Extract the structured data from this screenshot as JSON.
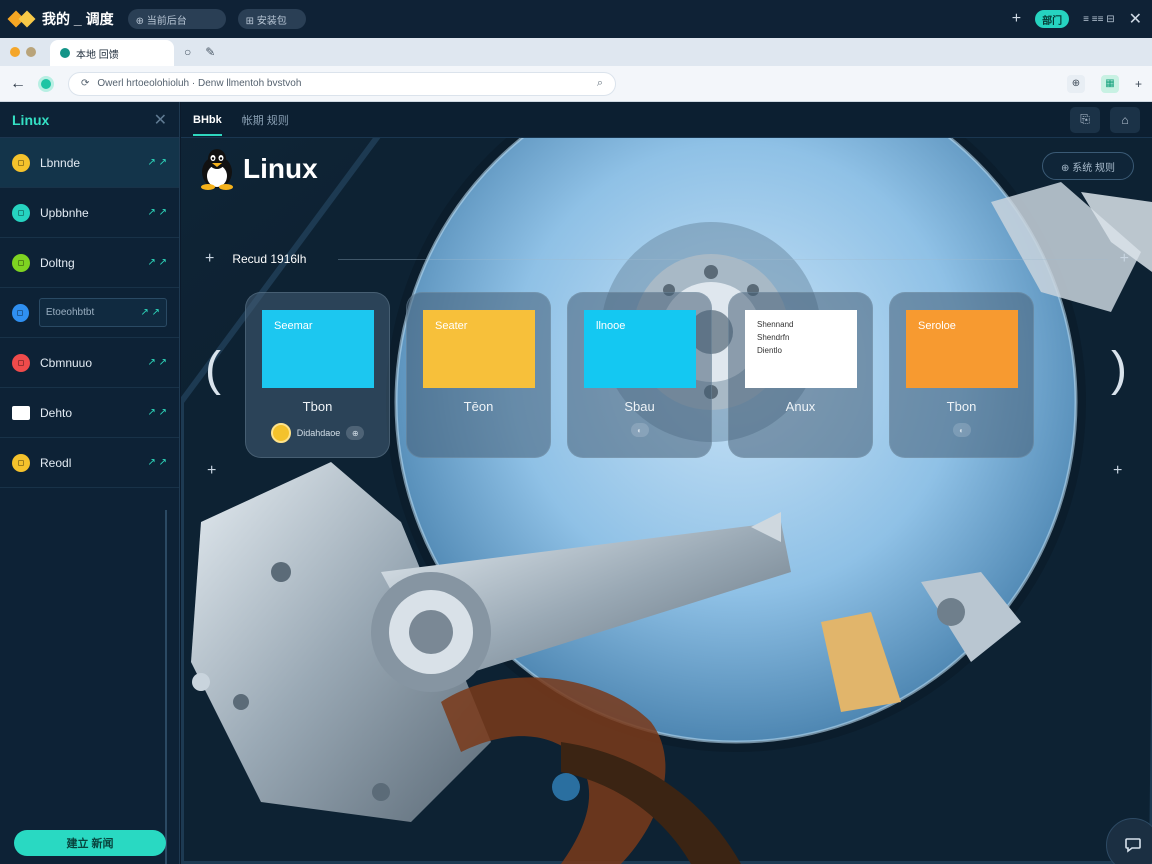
{
  "app": {
    "brand": "我的 _ 调度",
    "pill_one": "⊕ 当前后台",
    "pill_two": "⊞ 安装包"
  },
  "topbar": {
    "badge": "部门",
    "controls": "≡ ≡≡ ⊟"
  },
  "browser": {
    "tab_title": "本地 回馈",
    "url": "Owerl hrtoeolohioluh · Denw llmentoh bvstvoh"
  },
  "sidebar": {
    "title": "Linux",
    "items": [
      {
        "label": "Lbnnde",
        "color": "#f4c22c"
      },
      {
        "label": "Upbbnhe",
        "color": "#26d3c0"
      },
      {
        "label": "Doltng",
        "color": "#7ed321"
      },
      {
        "label": "Etoeohbtbt",
        "color": "#2f8ff0"
      },
      {
        "label": "Cbmnuuo",
        "color": "#ef4b4b"
      },
      {
        "label": "Dehto",
        "color": "#ffffff"
      },
      {
        "label": "Reodl",
        "color": "#f4c22c"
      }
    ],
    "arrow": "↗ ↗",
    "cta": "建立 新闻"
  },
  "main": {
    "tabs": [
      "BHbk",
      "帐期 规则"
    ],
    "title": "Linux",
    "ghost_button": "⊕ 系统 规则",
    "section_label": "Recud 1916lh",
    "cards": [
      {
        "tile_text": "Seemar",
        "tile_color": "#1cc7f0",
        "caption": "Tbon",
        "meta": "Didahdaoe",
        "meta_icon": "⊕"
      },
      {
        "tile_text": "Seater",
        "tile_color": "#f7c03a",
        "caption": "Tēon",
        "meta": "",
        "meta_icon": ""
      },
      {
        "tile_text": "llnooe",
        "tile_color": "#14c8f2",
        "caption": "Sbau",
        "meta": "",
        "meta_icon": "◐"
      },
      {
        "tile_lines": [
          "Shennand",
          "Shendrfn",
          "Dientlo"
        ],
        "tile_color": "#ffffff",
        "caption": "Anux",
        "meta": "",
        "meta_icon": ""
      },
      {
        "tile_text": "Seroloe",
        "tile_color": "#f79a30",
        "caption": "Tbon",
        "meta": "",
        "meta_icon": "◐"
      }
    ]
  }
}
